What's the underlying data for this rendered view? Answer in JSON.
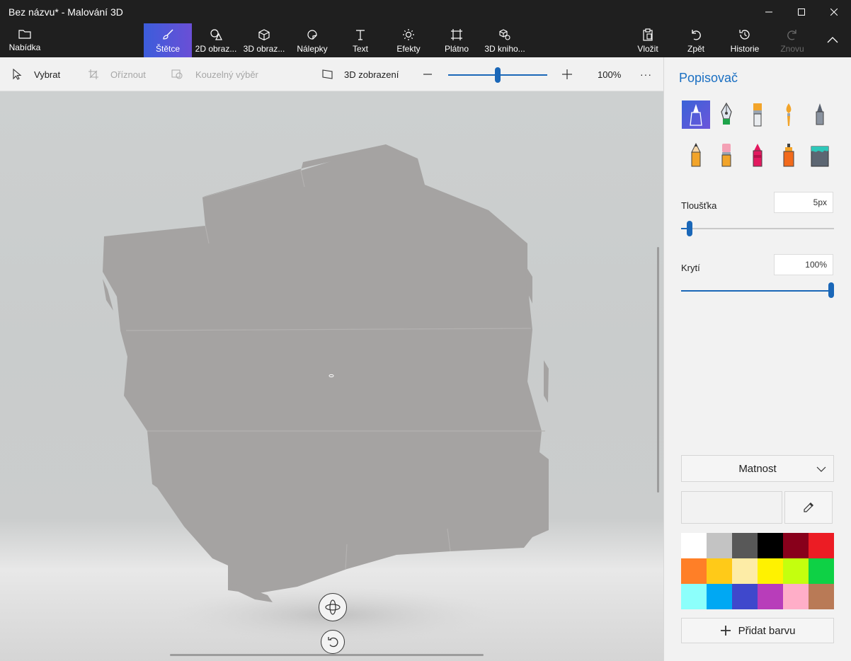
{
  "window": {
    "title": "Bez názvu* - Malování 3D"
  },
  "ribbon": {
    "menu_label": "Nabídka",
    "tabs": [
      {
        "label": "Štětce",
        "icon": "brush-icon",
        "active": true
      },
      {
        "label": "2D obraz...",
        "icon": "shapes-2d-icon"
      },
      {
        "label": "3D obraz...",
        "icon": "cube-3d-icon"
      },
      {
        "label": "Nálepky",
        "icon": "sticker-icon"
      },
      {
        "label": "Text",
        "icon": "text-icon"
      },
      {
        "label": "Efekty",
        "icon": "sun-icon"
      },
      {
        "label": "Plátno",
        "icon": "canvas-icon"
      },
      {
        "label": "3D kniho...",
        "icon": "library-3d-icon"
      }
    ],
    "paste_label": "Vložit",
    "undo_label": "Zpět",
    "history_label": "Historie",
    "redo_label": "Znovu"
  },
  "toolbar": {
    "select_label": "Vybrat",
    "crop_label": "Oříznout",
    "magic_select_label": "Kouzelný výběr",
    "view3d_label": "3D zobrazení",
    "zoom_value": "100%",
    "zoom_level": 0.5,
    "more_label": "···"
  },
  "panel": {
    "title": "Popisovač",
    "brushes": [
      {
        "name": "marker",
        "icon": "marker-icon",
        "selected": true
      },
      {
        "name": "calligraphy-pen",
        "icon": "calligraphy-pen-icon"
      },
      {
        "name": "oil-brush",
        "icon": "oil-brush-icon"
      },
      {
        "name": "watercolor",
        "icon": "watercolor-icon"
      },
      {
        "name": "pixel-pen",
        "icon": "pixel-pen-icon"
      },
      {
        "name": "pencil",
        "icon": "pencil-icon"
      },
      {
        "name": "eraser",
        "icon": "eraser-icon"
      },
      {
        "name": "crayon",
        "icon": "crayon-icon"
      },
      {
        "name": "spray-can",
        "icon": "spray-can-icon"
      },
      {
        "name": "fill",
        "icon": "fill-bucket-icon"
      }
    ],
    "thickness_label": "Tloušťka",
    "thickness_value": "5px",
    "thickness_level": 0.05,
    "opacity_label": "Krytí",
    "opacity_value": "100%",
    "opacity_level": 1.0,
    "finish_value": "Matnost",
    "add_color_label": "Přidat barvu",
    "palette": [
      "#ffffff",
      "#c3c3c3",
      "#585858",
      "#000000",
      "#88001b",
      "#ec1c24",
      "#ff7f27",
      "#ffca18",
      "#fdeca6",
      "#fff200",
      "#c4ff0e",
      "#0ed145",
      "#8cfffb",
      "#00a8f3",
      "#3f48cc",
      "#b83dba",
      "#ffaec8",
      "#b97a56"
    ]
  }
}
